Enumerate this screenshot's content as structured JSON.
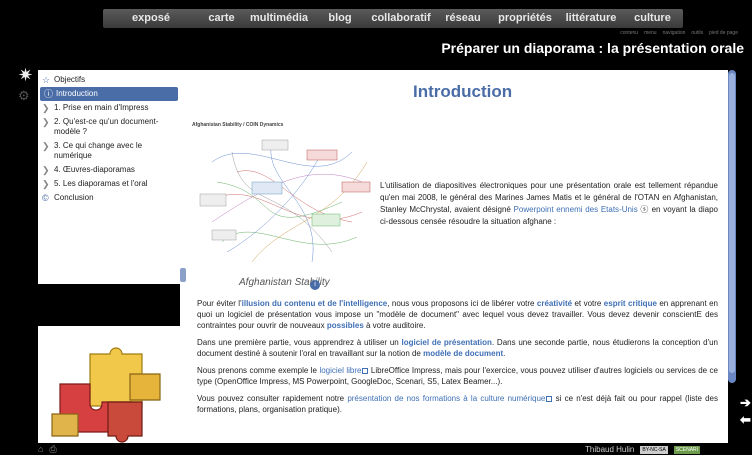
{
  "topnav": [
    "exposé",
    "carte",
    "multimédia",
    "blog",
    "collaboratif",
    "réseau",
    "propriétés",
    "littérature",
    "culture"
  ],
  "subnav": [
    "contenu",
    "menu",
    "navigation",
    "outils",
    "pied de page"
  ],
  "page_title": "Préparer un diaporama : la présentation orale",
  "sidebar": {
    "items": [
      {
        "icon": "star-icon",
        "label": "Objectifs"
      },
      {
        "icon": "info-icon",
        "label": "Introduction",
        "active": true
      },
      {
        "icon": "chevron-right-icon",
        "label": "1. Prise en main d'Impress"
      },
      {
        "icon": "chevron-right-icon",
        "label": "2. Qu'est-ce qu'un document-modèle ?"
      },
      {
        "icon": "chevron-right-icon",
        "label": "3. Ce qui change avec le numérique"
      },
      {
        "icon": "chevron-right-icon",
        "label": "4. Œuvres-diaporamas"
      },
      {
        "icon": "chevron-right-icon",
        "label": "5. Les diaporamas et l'oral"
      },
      {
        "icon": "copyright-icon",
        "label": "Conclusion"
      }
    ]
  },
  "main": {
    "heading": "Introduction",
    "diagram_title": "Afghanistan Stability / COIN Dynamics",
    "diagram_caption": "Afghanistan Stability",
    "p1_a": "L'utilisation de diapositives électroniques pour une présentation orale est tellement répandue qu'en mai 2008, le général des Marines James Matis et le général de l'OTAN en Afghanistan, Stanley McChrystal, avaient désigné ",
    "p1_link": "Powerpoint ennemi des Etats-Unis",
    "p1_b": " en voyant la diapo ci-dessous censée résoudre la situation afghane :",
    "p2_a": "Pour éviter l'",
    "p2_k1": "illusion du contenu et de l'intelligence",
    "p2_b": ", nous vous proposons ici de libérer votre ",
    "p2_k2": "créativité",
    "p2_c": " et votre ",
    "p2_k3": "esprit critique",
    "p2_d": " en apprenant en quoi un logiciel de présentation vous impose un \"modèle de document\" avec lequel vous devez travailler. Vous devez devenir conscientE des contraintes pour ouvrir de nouveaux ",
    "p2_k4": "possibles",
    "p2_e": " à votre auditoire.",
    "p3_a": "Dans une première partie, vous apprendrez à utiliser un ",
    "p3_k1": "logiciel de présentation",
    "p3_b": ". Dans une seconde partie, nous étudierons la conception d'un document destiné à soutenir l'oral en travaillant sur la notion de ",
    "p3_k2": "modèle de document",
    "p3_c": ".",
    "p4_a": "Nous prenons comme exemple le ",
    "p4_link": "logiciel libre",
    "p4_b": " LibreOffice Impress, mais pour l'exercice, vous pouvez utiliser d'autres logiciels ou services de ce type (OpenOffice Impress, MS Powerpoint, GoogleDoc, Scenari, S5, Latex Beamer...).",
    "p5_a": "Vous pouvez consulter rapidement notre ",
    "p5_link": "présentation de nos formations à la culture numérique",
    "p5_b": " si ce n'est déjà fait ou pour rappel (liste des formations, plans, organisation pratique)."
  },
  "footer": {
    "author": "Thibaud Hulin",
    "license": "BY-NC-SA",
    "badge": "SCENARI"
  },
  "colors": {
    "accent": "#4a6da8",
    "link": "#3f6fb5",
    "background": "#000000"
  }
}
